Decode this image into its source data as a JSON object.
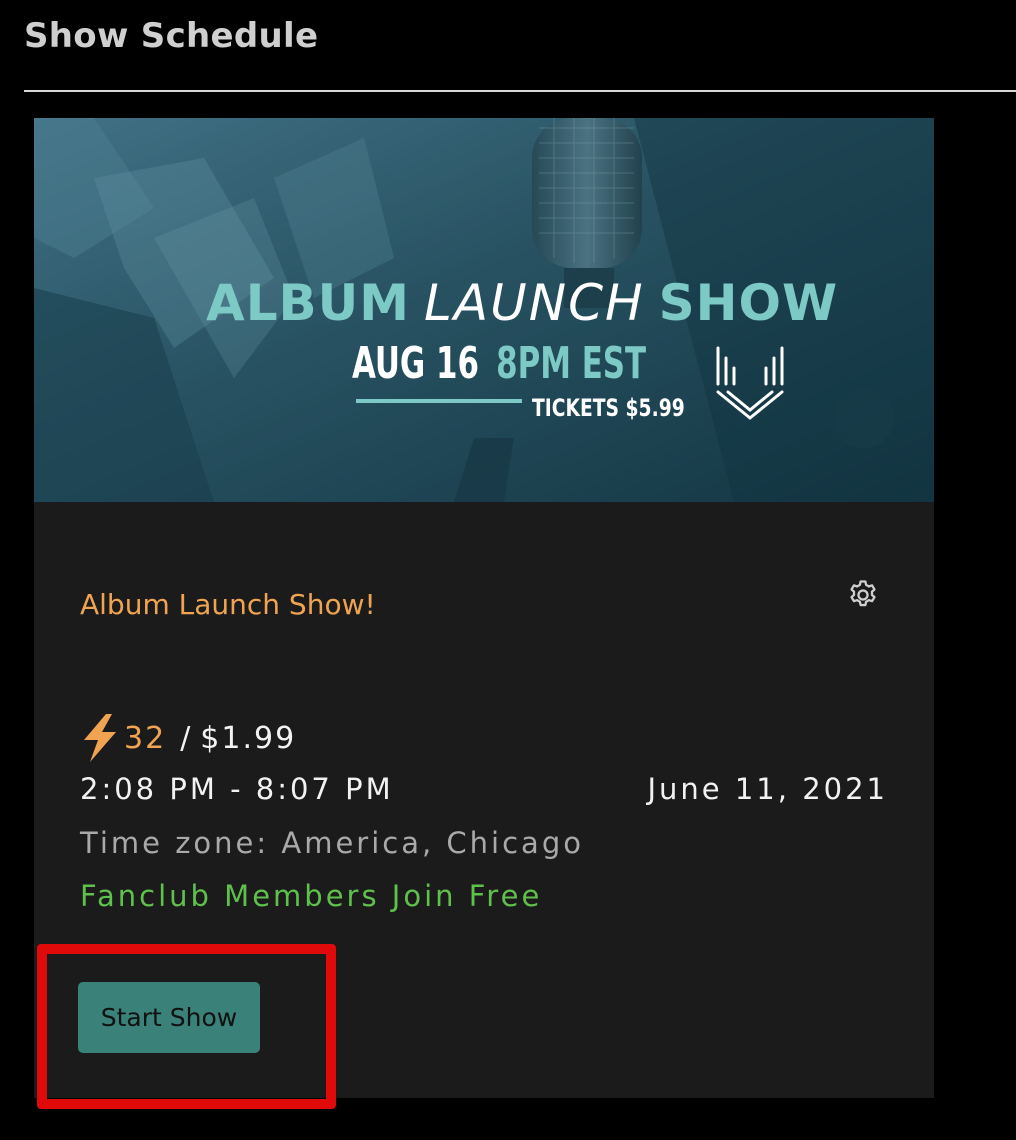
{
  "header": {
    "title": "Show Schedule"
  },
  "show": {
    "banner": {
      "title_word1": "ALBUM",
      "title_word2": "LAUNCH",
      "title_word3": "SHOW",
      "date_part1": "AUG 16",
      "date_part2": "8PM EST",
      "tickets": "TICKETS $5.99"
    },
    "title": "Album Launch Show!",
    "count": "32",
    "separator": "/",
    "price": "$1.99",
    "time_range": "2:08 PM - 8:07 PM",
    "date": "June 11, 2021",
    "timezone": "Time zone: America, Chicago",
    "fanclub_note": "Fanclub Members Join Free",
    "start_button_label": "Start Show"
  },
  "icons": {
    "settings": "gear-icon",
    "bolt": "lightning-bolt-icon"
  },
  "colors": {
    "background": "#000000",
    "card": "#1b1b1b",
    "title_accent": "#f0a452",
    "fanclub_green": "#5fc04c",
    "button_teal": "#3a8279",
    "highlight_red": "#e10a0a",
    "banner_teal": "#7cc9c5"
  }
}
